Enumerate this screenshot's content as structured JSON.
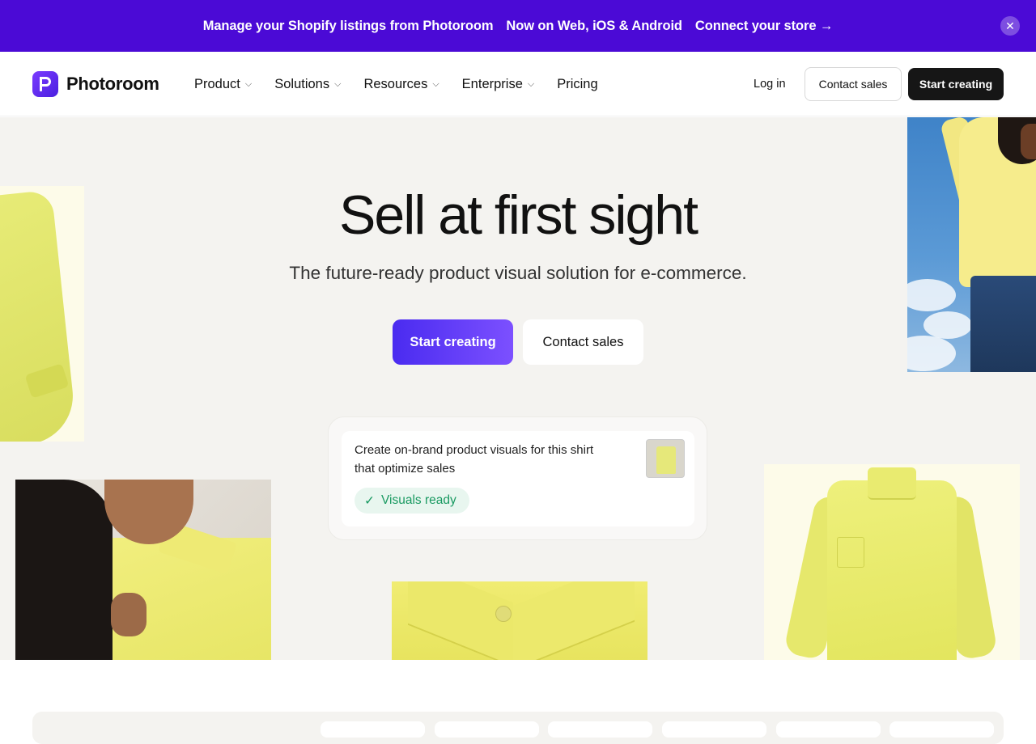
{
  "promo": {
    "part1": "Manage your Shopify listings from Photoroom",
    "part2": "Now on Web, iOS & Android",
    "part3": "Connect your store →",
    "close": "✕"
  },
  "header": {
    "logo_text": "Photoroom",
    "nav": [
      {
        "label": "Product",
        "has_dropdown": true
      },
      {
        "label": "Solutions",
        "has_dropdown": true
      },
      {
        "label": "Resources",
        "has_dropdown": true
      },
      {
        "label": "Enterprise",
        "has_dropdown": true
      },
      {
        "label": "Pricing",
        "has_dropdown": false
      }
    ],
    "chevron": "⌄",
    "login": "Log in",
    "contact_sales": "Contact sales",
    "start_creating": "Start creating"
  },
  "hero": {
    "title": "Sell at first sight",
    "subtitle": "The future-ready product visual solution for e-commerce.",
    "primary_cta": "Start creating",
    "secondary_cta": "Contact sales"
  },
  "prompt_card": {
    "text": "Create on-brand product visuals for this shirt that optimize sales",
    "status": "Visuals ready",
    "status_icon": "✓"
  },
  "colors": {
    "promo_bg": "#4b0ad6",
    "accent": "#5b33f5",
    "dark_button": "#161616",
    "hero_bg": "#f4f3f0",
    "status_green": "#1a9a62"
  }
}
